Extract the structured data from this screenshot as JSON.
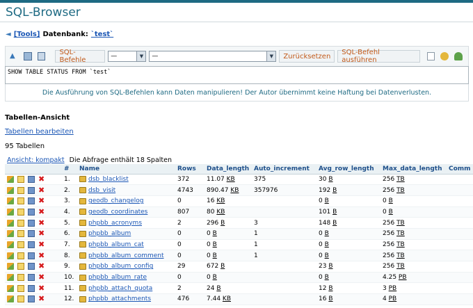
{
  "app": {
    "title": "SQL-Browser"
  },
  "breadcrumb": {
    "tools": "[Tools]",
    "label": "Datenbank:",
    "db": "`test`"
  },
  "toolbar": {
    "sql_commands_label": "SQL-Befehle",
    "select1_value": "—",
    "select2_value": "—",
    "reset_label": "Zurücksetzen",
    "execute_label": "SQL-Befehl ausführen"
  },
  "sql": {
    "query": "SHOW TABLE STATUS FROM `test`"
  },
  "warning": "Die Ausführung von SQL-Befehlen kann Daten manipulieren! Der Autor übernimmt keine Haftung bei Datenverlusten.",
  "section": {
    "title": "Tabellen-Ansicht",
    "edit_link": "Tabellen bearbeiten",
    "count": "95 Tabellen"
  },
  "view": {
    "toggle": "Ansicht: kompakt",
    "info": "Die Abfrage enthält 18 Spalten"
  },
  "table": {
    "headers": [
      "#",
      "Name",
      "Rows",
      "Data_length",
      "Auto_increment",
      "Avg_row_length",
      "Max_data_length",
      "Comm"
    ],
    "rows": [
      {
        "n": "1.",
        "name": "dsb_blacklist",
        "rows": "372",
        "dl": "11.07",
        "dlu": "KB",
        "ai": "375",
        "arl": "30",
        "arlu": "B",
        "mdl": "256",
        "mdlu": "TB"
      },
      {
        "n": "2.",
        "name": "dsb_visit",
        "rows": "4743",
        "dl": "890.47",
        "dlu": "KB",
        "ai": "357976",
        "arl": "192",
        "arlu": "B",
        "mdl": "256",
        "mdlu": "TB"
      },
      {
        "n": "3.",
        "name": "geodb_changelog",
        "rows": "0",
        "dl": "16",
        "dlu": "KB",
        "ai": "",
        "arl": "0",
        "arlu": "B",
        "mdl": "0",
        "mdlu": "B"
      },
      {
        "n": "4.",
        "name": "geodb_coordinates",
        "rows": "807",
        "dl": "80",
        "dlu": "KB",
        "ai": "",
        "arl": "101",
        "arlu": "B",
        "mdl": "0",
        "mdlu": "B"
      },
      {
        "n": "5.",
        "name": "phpbb_acronyms",
        "rows": "2",
        "dl": "296",
        "dlu": "B",
        "ai": "3",
        "arl": "148",
        "arlu": "B",
        "mdl": "256",
        "mdlu": "TB"
      },
      {
        "n": "6.",
        "name": "phpbb_album",
        "rows": "0",
        "dl": "0",
        "dlu": "B",
        "ai": "1",
        "arl": "0",
        "arlu": "B",
        "mdl": "256",
        "mdlu": "TB"
      },
      {
        "n": "7.",
        "name": "phpbb_album_cat",
        "rows": "0",
        "dl": "0",
        "dlu": "B",
        "ai": "1",
        "arl": "0",
        "arlu": "B",
        "mdl": "256",
        "mdlu": "TB"
      },
      {
        "n": "8.",
        "name": "phpbb_album_comment",
        "rows": "0",
        "dl": "0",
        "dlu": "B",
        "ai": "1",
        "arl": "0",
        "arlu": "B",
        "mdl": "256",
        "mdlu": "TB"
      },
      {
        "n": "9.",
        "name": "phpbb_album_config",
        "rows": "29",
        "dl": "672",
        "dlu": "B",
        "ai": "",
        "arl": "23",
        "arlu": "B",
        "mdl": "256",
        "mdlu": "TB"
      },
      {
        "n": "10.",
        "name": "phpbb_album_rate",
        "rows": "0",
        "dl": "0",
        "dlu": "B",
        "ai": "",
        "arl": "0",
        "arlu": "B",
        "mdl": "4.25",
        "mdlu": "PB"
      },
      {
        "n": "11.",
        "name": "phpbb_attach_quota",
        "rows": "2",
        "dl": "24",
        "dlu": "B",
        "ai": "",
        "arl": "12",
        "arlu": "B",
        "mdl": "3",
        "mdlu": "PB"
      },
      {
        "n": "12.",
        "name": "phpbb_attachments",
        "rows": "476",
        "dl": "7.44",
        "dlu": "KB",
        "ai": "",
        "arl": "16",
        "arlu": "B",
        "mdl": "4",
        "mdlu": "PB"
      }
    ]
  }
}
